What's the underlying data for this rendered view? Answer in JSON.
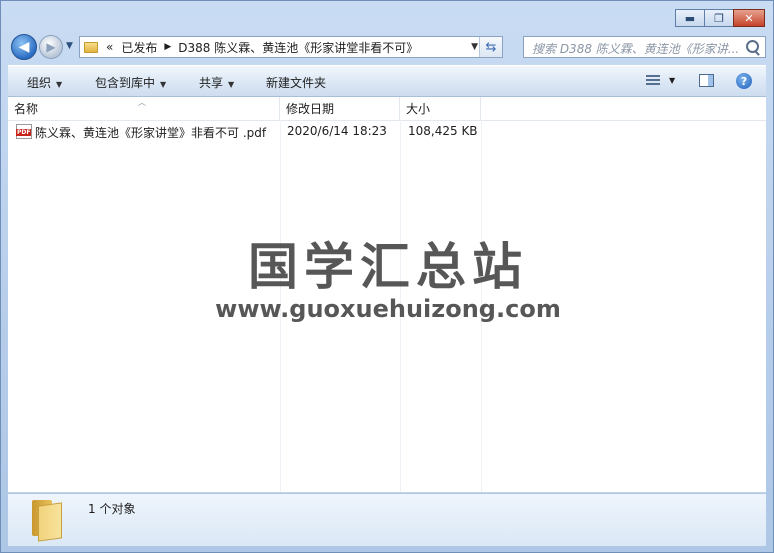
{
  "window": {
    "caption": {
      "minimize": "▬",
      "maximize": "❐",
      "close": "✕"
    }
  },
  "nav": {
    "back": "◀",
    "forward": "▶",
    "breadcrumb_overflow": "«",
    "breadcrumb": [
      "已发布",
      "D388 陈义霖、黄连池《形家讲堂非看不可》"
    ],
    "separator": "▶",
    "search_placeholder": "搜索 D388 陈义霖、黄连池《形家讲..."
  },
  "toolbar": {
    "organize": "组织",
    "include_in_library": "包含到库中",
    "share": "共享",
    "new_folder": "新建文件夹",
    "help": "?"
  },
  "columns": {
    "name": "名称",
    "modified": "修改日期",
    "size": "大小"
  },
  "files": [
    {
      "name": "陈义霖、黄连池《形家讲堂》非看不可 .pdf",
      "modified": "2020/6/14 18:23",
      "size": "108,425 KB",
      "icon": "pdf-icon",
      "icon_text": "PDF"
    }
  ],
  "watermark": {
    "title": "国学汇总站",
    "url": "www.guoxuehuizong.com"
  },
  "status": {
    "count": "1 个对象"
  }
}
